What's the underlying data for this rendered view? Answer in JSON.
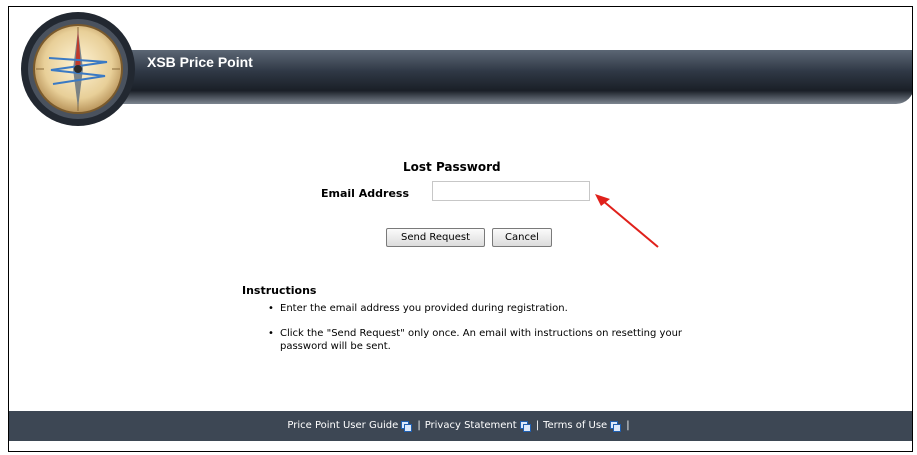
{
  "header": {
    "app_title": "XSB Price Point"
  },
  "form": {
    "title": "Lost Password",
    "email_label": "Email Address",
    "email_value": "",
    "send_label": "Send Request",
    "cancel_label": "Cancel"
  },
  "instructions": {
    "title": "Instructions",
    "items": [
      "Enter the email address you provided during registration.",
      "Click the \"Send Request\" only once. An email with instructions on resetting your password will be sent."
    ]
  },
  "footer": {
    "links": [
      {
        "label": "Price Point User Guide"
      },
      {
        "label": "Privacy Statement"
      },
      {
        "label": "Terms of Use"
      }
    ],
    "separator": "|"
  },
  "colors": {
    "footer_bg": "#3d4754",
    "annotation_arrow": "#e0211b"
  },
  "icons": {
    "logo": "compass-icon",
    "external_link": "new-window-icon",
    "annotation": "arrow-icon"
  }
}
